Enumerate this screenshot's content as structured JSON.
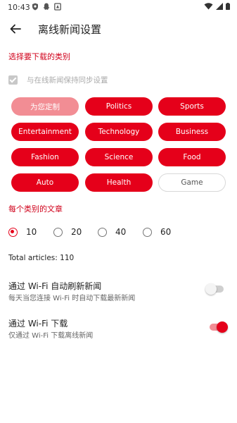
{
  "status_bar": {
    "time": "10:43"
  },
  "app_bar": {
    "title": "离线新闻设置"
  },
  "categories_section": {
    "header": "选择要下载的类别",
    "sync_label": "与在线新闻保持同步设置",
    "sync_checked": true,
    "chips": [
      {
        "label": "为您定制",
        "style": "light"
      },
      {
        "label": "Politics",
        "style": "selected"
      },
      {
        "label": "Sports",
        "style": "selected"
      },
      {
        "label": "Entertainment",
        "style": "selected"
      },
      {
        "label": "Technology",
        "style": "selected"
      },
      {
        "label": "Business",
        "style": "selected"
      },
      {
        "label": "Fashion",
        "style": "selected"
      },
      {
        "label": "Science",
        "style": "selected"
      },
      {
        "label": "Food",
        "style": "selected"
      },
      {
        "label": "Auto",
        "style": "selected"
      },
      {
        "label": "Health",
        "style": "selected"
      },
      {
        "label": "Game",
        "style": "unselected"
      }
    ]
  },
  "articles_section": {
    "header": "每个类别的文章",
    "options": [
      "10",
      "20",
      "40",
      "60"
    ],
    "selected": "10",
    "total": "Total articles: 110"
  },
  "wifi_refresh": {
    "title": "通过 Wi-Fi 自动刷新新闻",
    "subtitle": "每天当您连接 Wi-Fi 时自动下载最新新闻",
    "enabled": false
  },
  "wifi_download": {
    "title": "通过 Wi-Fi 下载",
    "subtitle": "仅通过 Wi-Fi 下载离线新闻",
    "enabled": true
  },
  "colors": {
    "accent": "#e5001a",
    "accent_light": "#f28d94"
  }
}
